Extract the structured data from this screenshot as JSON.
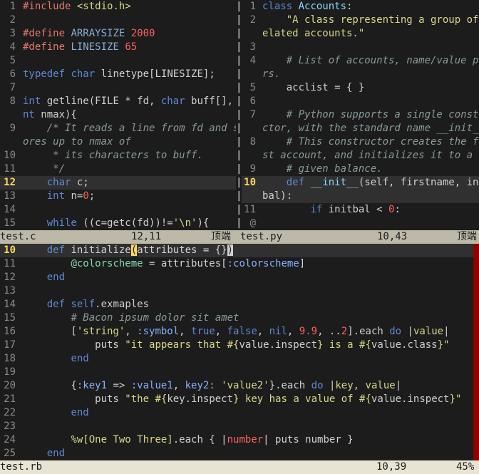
{
  "left_pane": {
    "lines": [
      {
        "n": "1",
        "html": "<span class='pp'>#include</span> <span class='str'>&lt;stdio.h&gt;</span>"
      },
      {
        "n": "2",
        "html": ""
      },
      {
        "n": "3",
        "html": "<span class='pp'>#define</span> <span class='ty'>ARRAYSIZE</span> <span class='num'>2000</span>"
      },
      {
        "n": "4",
        "html": "<span class='pp'>#define</span> <span class='ty'>LINESIZE</span> <span class='num'>65</span>"
      },
      {
        "n": "5",
        "html": ""
      },
      {
        "n": "6",
        "html": "<span class='k'>typedef</span> <span class='k'>char</span> linetype[LINESIZE];"
      },
      {
        "n": "7",
        "html": ""
      },
      {
        "n": "8",
        "html": "<span class='k'>int</span> getline(FILE * fd, <span class='k'>char</span> buff[], <span class='k'>i</span>"
      },
      {
        "n": "",
        "html": "<span class='k'>nt</span> nmax){"
      },
      {
        "n": "9",
        "html": "    <span class='cm'>/* It reads a line from fd and st</span>"
      },
      {
        "n": "",
        "html": "<span class='cm'>ores up to nmax of</span>"
      },
      {
        "n": "10",
        "html": "     <span class='cm'>* its characters to buff.</span>"
      },
      {
        "n": "11",
        "html": "     <span class='cm'>*/</span>"
      },
      {
        "n": "12",
        "html": "    <span class='k'>char</span> c;",
        "cur": true
      },
      {
        "n": "13",
        "html": "    <span class='k'>int</span> n=<span class='num'>0</span>;"
      },
      {
        "n": "14",
        "html": ""
      },
      {
        "n": "15",
        "html": "    <span class='k'>while</span> ((c=getc(fd))!=<span class='str'>'\\n'</span>){"
      }
    ],
    "status": {
      "name": "test.c",
      "pos": "12,11",
      "top": "顶端"
    }
  },
  "right_pane": {
    "lines": [
      {
        "n": "1",
        "html": "<span class='k'>class</span> <span class='cls'>Accounts</span>:"
      },
      {
        "n": "2",
        "html": "    <span class='str'>\"A class representing a group of r</span>"
      },
      {
        "n": "",
        "html": "<span class='str'>elated accounts.\"</span>"
      },
      {
        "n": "3",
        "html": ""
      },
      {
        "n": "4",
        "html": "    <span class='cm'># List of accounts, name/value pai</span>"
      },
      {
        "n": "",
        "html": "<span class='cm'>rs.</span>"
      },
      {
        "n": "5",
        "html": "    acclist = { }"
      },
      {
        "n": "6",
        "html": ""
      },
      {
        "n": "7",
        "html": "    <span class='cm'># Python supports a single constru</span>"
      },
      {
        "n": "",
        "html": "<span class='cm'>ctor, with the standard name __init__.</span>"
      },
      {
        "n": "8",
        "html": "    <span class='cm'># This constructor creates the fir</span>"
      },
      {
        "n": "",
        "html": "<span class='cm'>st account, and initializes it to a</span>"
      },
      {
        "n": "9",
        "html": "    <span class='cm'># given balance.</span>"
      },
      {
        "n": "10",
        "html": "    <span class='k'>def</span> <span class='fn'>__init__</span>(self, firstname, init",
        "cur": true
      },
      {
        "n": "",
        "html": "bal):",
        "cur": true
      },
      {
        "n": "11",
        "html": "        <span class='k'>if</span> initbal &lt; <span class='num'>0</span>:"
      },
      {
        "n": "@",
        "html": ""
      }
    ],
    "status": {
      "name": "test.py",
      "pos": "10,43",
      "top": "顶端"
    }
  },
  "bottom_pane": {
    "lines": [
      {
        "n": "10",
        "html": "    <span class='k'>def</span> initialize<span class='br'>(</span>attributes = {}<span class='cursor'>)</span>",
        "cur": true
      },
      {
        "n": "11",
        "html": "        <span class='iv'>@colorscheme</span> = attributes[<span class='sym'>:colorscheme</span>]"
      },
      {
        "n": "12",
        "html": "    <span class='k'>end</span>"
      },
      {
        "n": "13",
        "html": ""
      },
      {
        "n": "14",
        "html": "    <span class='k'>def</span> <span class='k'>self</span>.exmaples"
      },
      {
        "n": "15",
        "html": "        <span class='cm'># Bacon ipsum dolor sit amet</span>"
      },
      {
        "n": "16",
        "html": "        [<span class='str'>'string'</span>, <span class='sym'>:symbol</span>, <span class='k'>true</span>, <span class='k'>false</span>, <span class='k'>nil</span>, <span class='num'>9.9</span>, ..<span class='num'>2</span>].each <span class='k'>do</span> |<span class='str'>value</span>|"
      },
      {
        "n": "17",
        "html": "            puts <span class='str'>\"it appears that #{</span>value.inspect<span class='str'>} is a #{</span>value.class<span class='str'>}\"</span>"
      },
      {
        "n": "18",
        "html": "        <span class='k'>end</span>"
      },
      {
        "n": "19",
        "html": ""
      },
      {
        "n": "20",
        "html": "        {<span class='sym'>:key1</span> =&gt; <span class='sym'>:value1</span>, <span class='sym'>key2:</span> <span class='str'>'value2'</span>}.each <span class='k'>do</span> |<span class='str'>key</span>, <span class='str'>value</span>|"
      },
      {
        "n": "21",
        "html": "            puts <span class='str'>\"the #{</span>key.inspect<span class='str'>} key has a value of #{</span>value.inspect<span class='str'>}\"</span>"
      },
      {
        "n": "22",
        "html": "        <span class='k'>end</span>"
      },
      {
        "n": "23",
        "html": ""
      },
      {
        "n": "24",
        "html": "        <span class='str'>%w[One Two Three]</span>.each { |<span class='num'>number</span>| puts number }"
      },
      {
        "n": "25",
        "html": "    <span class='k'>end</span>"
      }
    ],
    "status": {
      "name": "test.rb",
      "pos": "10,39",
      "pct": "45%"
    }
  }
}
